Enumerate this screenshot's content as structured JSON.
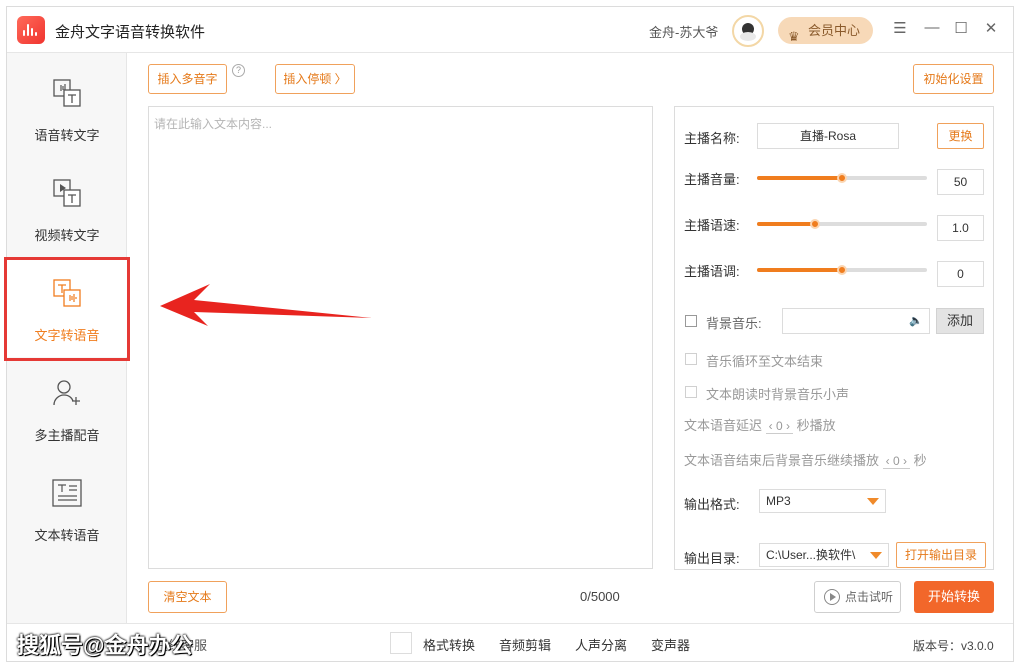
{
  "titlebar": {
    "app_title": "金舟文字语音转换软件",
    "user_name": "金舟-苏大爷",
    "vip_label": "会员中心",
    "menu_icon": "☰",
    "minimize_icon": "—",
    "maximize_icon": "☐",
    "close_icon": "✕"
  },
  "sidebar": {
    "items": [
      {
        "label": "语音转文字",
        "icon": "audio-to-text-icon"
      },
      {
        "label": "视频转文字",
        "icon": "video-to-text-icon"
      },
      {
        "label": "文字转语音",
        "icon": "text-to-speech-icon",
        "active": true
      },
      {
        "label": "多主播配音",
        "icon": "multi-anchor-icon"
      },
      {
        "label": "文本转语音",
        "icon": "document-to-speech-icon"
      }
    ]
  },
  "toolbar": {
    "insert_polyphone": "插入多音字",
    "insert_pause": "插入停顿 〉",
    "init_settings": "初始化设置",
    "help": "?"
  },
  "editor": {
    "placeholder": "请在此输入文本内容...",
    "clear_label": "清空文本",
    "count": "0/5000"
  },
  "settings": {
    "anchor_label": "主播名称:",
    "anchor_value": "直播-Rosa",
    "change_label": "更换",
    "volume_label": "主播音量:",
    "volume_value": "50",
    "speed_label": "主播语速:",
    "speed_value": "1.0",
    "pitch_label": "主播语调:",
    "pitch_value": "0",
    "bgm_label": "背景音乐:",
    "add_label": "添加",
    "loop_label": "音乐循环至文本结束",
    "quiet_label": "文本朗读时背景音乐小声",
    "delay_prefix": "文本语音延迟",
    "delay_value": "0",
    "delay_suffix": "秒播放",
    "continue_prefix": "文本语音结束后背景音乐继续播放",
    "continue_value": "0",
    "continue_suffix": "秒",
    "format_label": "输出格式:",
    "format_value": "MP3",
    "dir_label": "输出目录:",
    "dir_value": "C:\\User...换软件\\",
    "open_dir_label": "打开输出目录"
  },
  "actions": {
    "try_label": "点击试听",
    "start_label": "开始转换"
  },
  "footer": {
    "watermark": "搜狐号@金舟办公",
    "service_label": "在线客服",
    "links": [
      "格式转换",
      "音频剪辑",
      "人声分离",
      "变声器"
    ],
    "version": "版本号：v3.0.0"
  },
  "colors": {
    "accent": "#f07d1e",
    "start": "#f2672a",
    "highlight": "#e53935"
  },
  "slider_levels": {
    "volume": 0.5,
    "speed": 0.34,
    "pitch": 0.5
  }
}
